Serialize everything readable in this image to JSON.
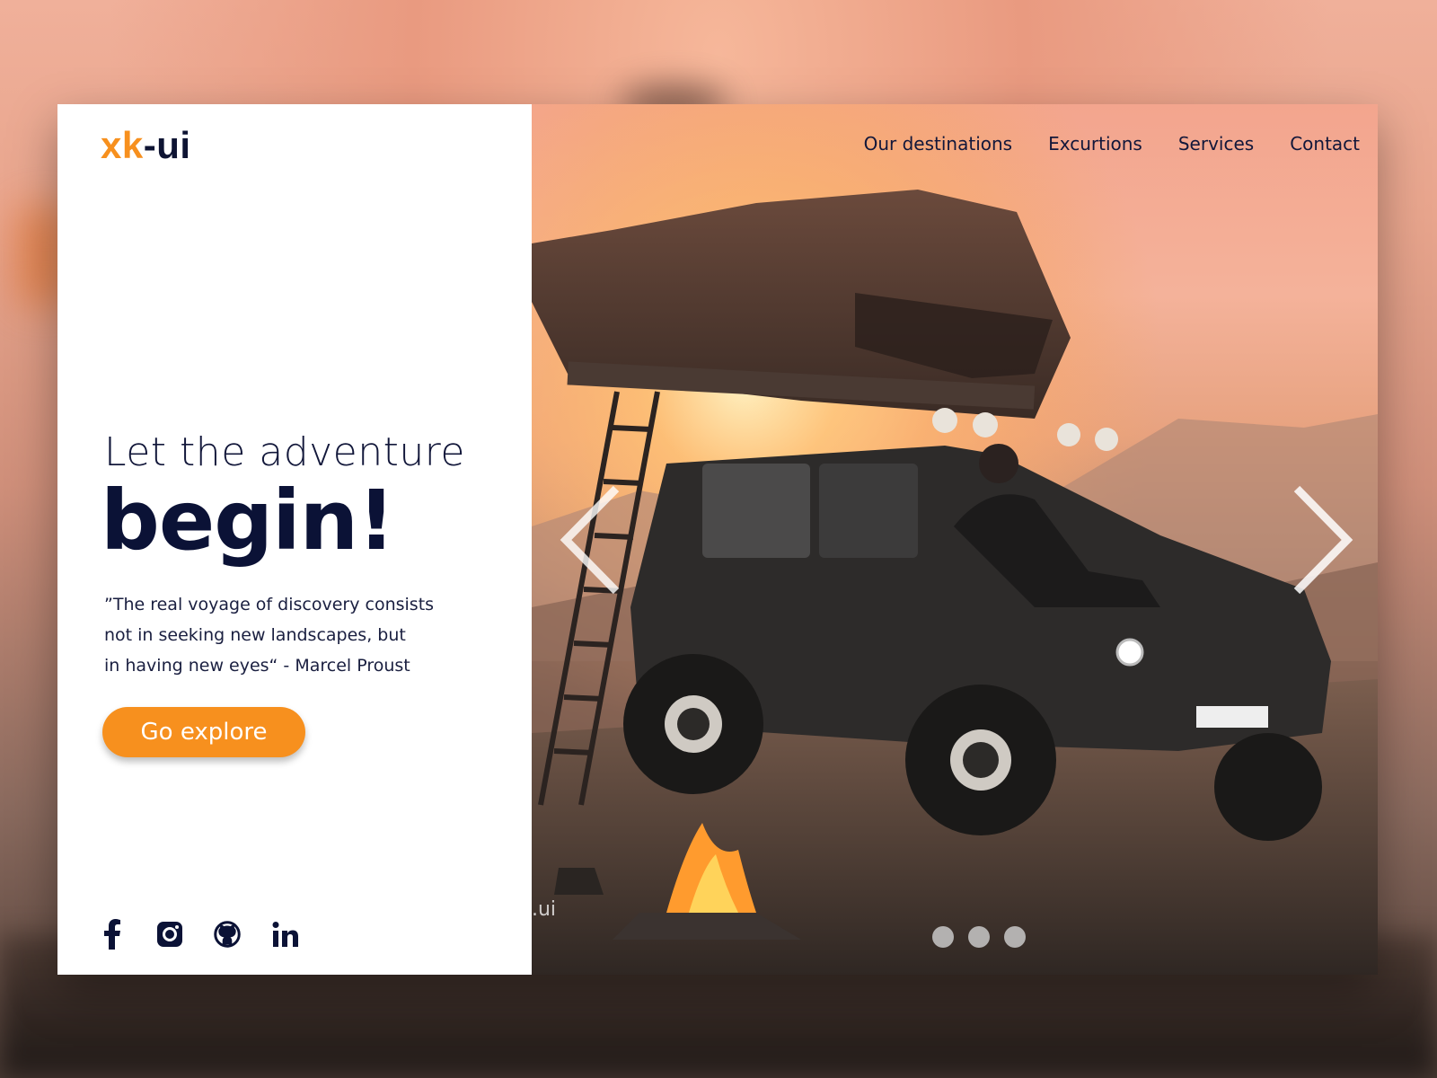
{
  "brand": {
    "name_accent": "xk",
    "name_rest": "-ui",
    "accent_color": "#f7901e",
    "dark_color": "#0b1236"
  },
  "nav": {
    "items": [
      {
        "label": "Our destinations"
      },
      {
        "label": "Excurtions"
      },
      {
        "label": "Services"
      },
      {
        "label": "Contact"
      }
    ]
  },
  "hero": {
    "headline_line1": "Let the adventure",
    "headline_line2": "begin!",
    "quote_lines": [
      "”The real voyage of discovery consists",
      "not in seeking new landscapes, but",
      "in having new eyes“ - Marcel Proust"
    ],
    "cta_label": "Go explore",
    "watermark": ".ui"
  },
  "socials": [
    {
      "icon": "facebook-icon",
      "glyph": "f"
    },
    {
      "icon": "instagram-icon"
    },
    {
      "icon": "github-icon"
    },
    {
      "icon": "linkedin-icon",
      "glyph": "in"
    }
  ],
  "carousel": {
    "slides_count": 3,
    "active_slide": 1
  }
}
